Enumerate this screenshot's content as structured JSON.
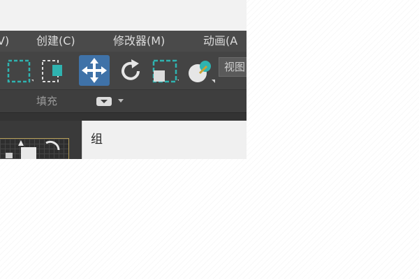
{
  "menubar": {
    "items": [
      {
        "label": "V)"
      },
      {
        "label": "创建(C)"
      },
      {
        "label": "修改器(M)"
      },
      {
        "label": "动画(A"
      }
    ]
  },
  "toolbar": {
    "tools": [
      {
        "icon": "rect-select-icon"
      },
      {
        "icon": "select-region-icon"
      },
      {
        "icon": "move-icon",
        "active": true
      },
      {
        "icon": "rotate-icon"
      },
      {
        "icon": "scale-icon"
      },
      {
        "icon": "snap-icon"
      }
    ],
    "viewport_label": "视图"
  },
  "ribbon": {
    "fill_label": "填充"
  },
  "dropdown": {
    "item_label": "组"
  },
  "colors": {
    "accent_blue": "#3f72a8",
    "teal": "#2fb3b0",
    "menubar_bg": "#4a4a4a"
  }
}
